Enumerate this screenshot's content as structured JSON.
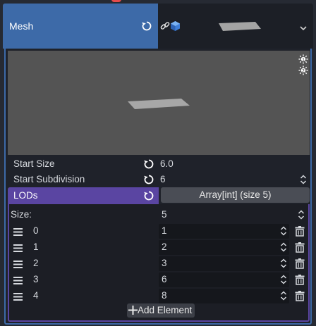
{
  "mesh": {
    "label": "Mesh",
    "revert_icon": "revert-icon",
    "link_icon": "link-icon",
    "resource_icon": "cube-icon",
    "dropdown_icon": "chevron-down-icon"
  },
  "preview": {
    "light1_icon": "light-icon",
    "light2_icon": "light-icon"
  },
  "start_size": {
    "label": "Start Size",
    "value": "6.0"
  },
  "start_subdivision": {
    "label": "Start Subdivision",
    "value": "6"
  },
  "lods": {
    "label": "LODs",
    "array_button": "Array[int] (size 5)"
  },
  "array": {
    "size_label": "Size:",
    "size_value": "5",
    "elements": [
      {
        "index": "0",
        "value": "1"
      },
      {
        "index": "1",
        "value": "2"
      },
      {
        "index": "2",
        "value": "3"
      },
      {
        "index": "3",
        "value": "6"
      },
      {
        "index": "4",
        "value": "8"
      }
    ],
    "add_button": "Add Element"
  },
  "colors": {
    "accent_blue": "#3d6aa8",
    "accent_purple": "#5a45a2",
    "background": "#262a33",
    "preview_bg": "#545454"
  }
}
